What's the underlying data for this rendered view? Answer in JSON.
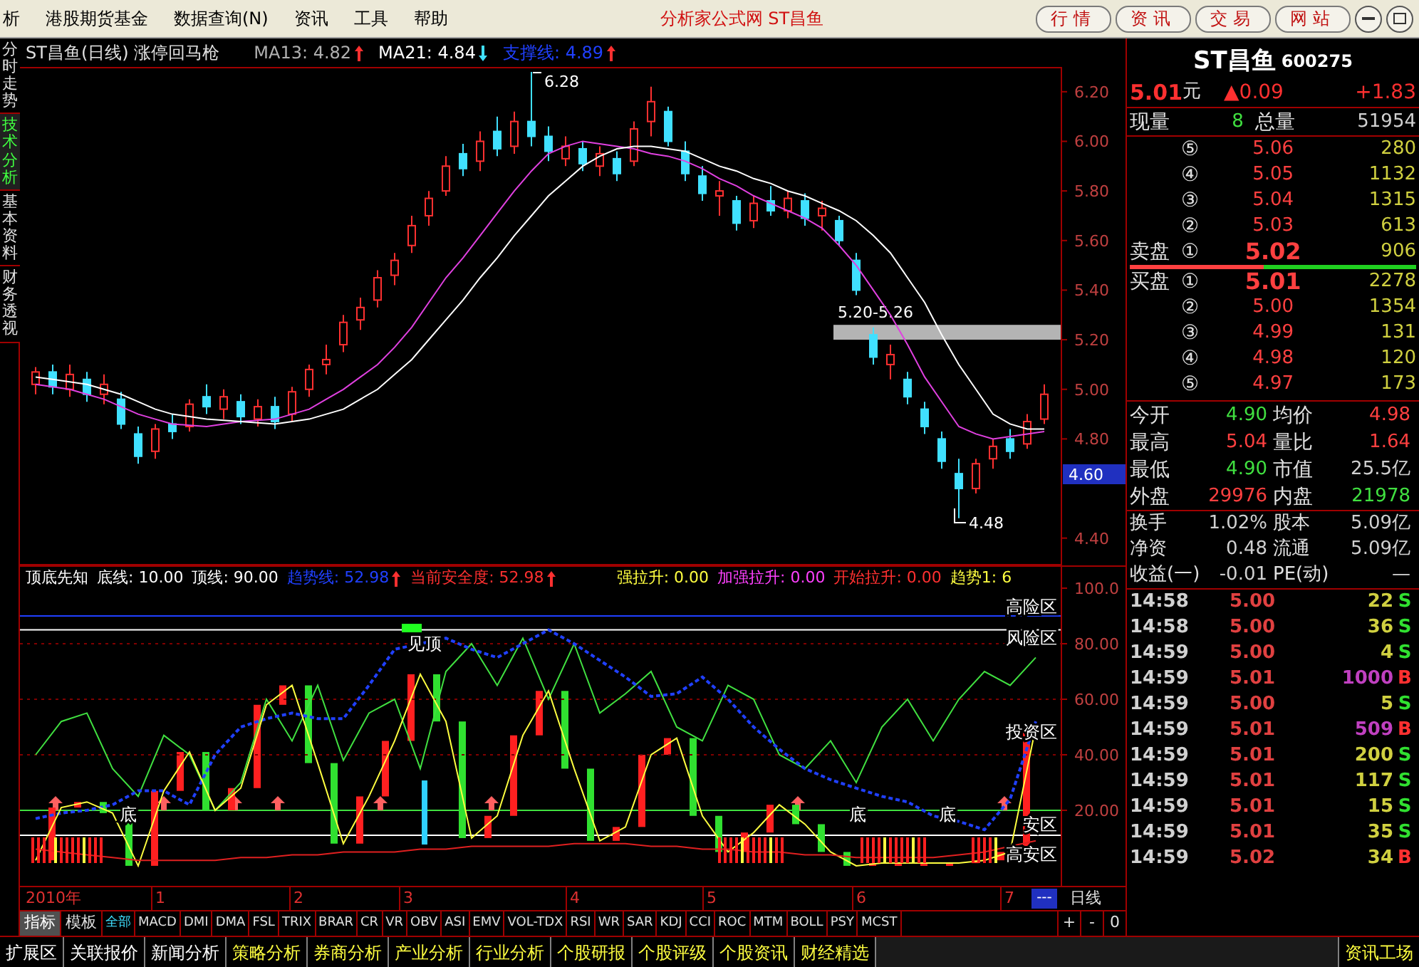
{
  "menu_bar": {
    "items": [
      "析",
      "港股期货基金",
      "数据查询(N)",
      "资讯",
      "工具",
      "帮助"
    ],
    "title": "分析家公式网 ST昌鱼",
    "buttons": [
      "行情",
      "资讯",
      "交易",
      "网站"
    ]
  },
  "side_tabs": [
    {
      "label": "分时走势",
      "selected": false
    },
    {
      "label": "技术分析",
      "selected": true
    },
    {
      "label": "基本资料",
      "selected": false
    },
    {
      "label": "财务透视",
      "selected": false
    }
  ],
  "price_chart": {
    "title": "ST昌鱼(日线) 涨停回马枪",
    "indicators": [
      {
        "label": "MA13: 4.82",
        "color": "#b0b0b0",
        "kind": "up"
      },
      {
        "label": "MA21: 4.84",
        "color": "#ffffff",
        "kind": "down"
      },
      {
        "label": "支撑线: 4.89",
        "color": "#2040ff",
        "kind": "up"
      }
    ],
    "high_label": "6.28",
    "low_label": "4.48",
    "zone_label": "5.20-5.26",
    "current_marker": "4.60",
    "chart_data": {
      "type": "candlestick",
      "ylim": [
        4.29,
        6.3
      ],
      "ohlc": [
        [
          5.02,
          5.09,
          4.98,
          5.07
        ],
        [
          5.07,
          5.1,
          4.98,
          5.01
        ],
        [
          5.0,
          5.1,
          4.97,
          5.06
        ],
        [
          5.04,
          5.07,
          4.95,
          4.98
        ],
        [
          4.98,
          5.06,
          4.94,
          5.02
        ],
        [
          4.96,
          4.99,
          4.84,
          4.86
        ],
        [
          4.82,
          4.85,
          4.7,
          4.73
        ],
        [
          4.75,
          4.86,
          4.72,
          4.84
        ],
        [
          4.86,
          4.9,
          4.8,
          4.83
        ],
        [
          4.85,
          4.96,
          4.83,
          4.94
        ],
        [
          4.97,
          5.02,
          4.9,
          4.93
        ],
        [
          4.92,
          5.0,
          4.88,
          4.97
        ],
        [
          4.95,
          4.98,
          4.86,
          4.89
        ],
        [
          4.88,
          4.96,
          4.85,
          4.93
        ],
        [
          4.93,
          4.97,
          4.84,
          4.87
        ],
        [
          4.9,
          5.01,
          4.87,
          4.99
        ],
        [
          5.0,
          5.1,
          4.97,
          5.08
        ],
        [
          5.1,
          5.18,
          5.06,
          5.12
        ],
        [
          5.18,
          5.3,
          5.15,
          5.27
        ],
        [
          5.28,
          5.37,
          5.24,
          5.33
        ],
        [
          5.36,
          5.48,
          5.33,
          5.45
        ],
        [
          5.46,
          5.55,
          5.42,
          5.52
        ],
        [
          5.58,
          5.7,
          5.55,
          5.66
        ],
        [
          5.7,
          5.8,
          5.66,
          5.77
        ],
        [
          5.8,
          5.94,
          5.78,
          5.9
        ],
        [
          5.95,
          5.99,
          5.86,
          5.89
        ],
        [
          5.92,
          6.04,
          5.88,
          6.0
        ],
        [
          6.04,
          6.1,
          5.94,
          5.97
        ],
        [
          5.98,
          6.12,
          5.95,
          6.08
        ],
        [
          6.08,
          6.28,
          5.98,
          6.02
        ],
        [
          6.02,
          6.06,
          5.92,
          5.96
        ],
        [
          5.93,
          6.02,
          5.9,
          5.98
        ],
        [
          5.97,
          6.0,
          5.88,
          5.91
        ],
        [
          5.9,
          5.98,
          5.86,
          5.95
        ],
        [
          5.93,
          5.96,
          5.84,
          5.87
        ],
        [
          5.92,
          6.08,
          5.9,
          6.05
        ],
        [
          6.08,
          6.22,
          6.02,
          6.16
        ],
        [
          6.12,
          6.14,
          5.98,
          6.0
        ],
        [
          5.96,
          6.0,
          5.84,
          5.87
        ],
        [
          5.86,
          5.9,
          5.76,
          5.79
        ],
        [
          5.78,
          5.84,
          5.7,
          5.8
        ],
        [
          5.76,
          5.78,
          5.64,
          5.67
        ],
        [
          5.68,
          5.78,
          5.65,
          5.75
        ],
        [
          5.76,
          5.82,
          5.7,
          5.72
        ],
        [
          5.72,
          5.8,
          5.69,
          5.77
        ],
        [
          5.76,
          5.79,
          5.66,
          5.69
        ],
        [
          5.7,
          5.76,
          5.64,
          5.73
        ],
        [
          5.68,
          5.7,
          5.58,
          5.6
        ],
        [
          5.52,
          5.55,
          5.38,
          5.4
        ],
        [
          5.22,
          5.25,
          5.1,
          5.13
        ],
        [
          5.1,
          5.18,
          5.04,
          5.14
        ],
        [
          5.04,
          5.07,
          4.94,
          4.97
        ],
        [
          4.92,
          4.95,
          4.82,
          4.85
        ],
        [
          4.8,
          4.83,
          4.68,
          4.71
        ],
        [
          4.66,
          4.72,
          4.48,
          4.6
        ],
        [
          4.6,
          4.72,
          4.58,
          4.7
        ],
        [
          4.72,
          4.8,
          4.68,
          4.77
        ],
        [
          4.8,
          4.84,
          4.72,
          4.75
        ],
        [
          4.78,
          4.9,
          4.76,
          4.87
        ],
        [
          4.88,
          5.02,
          4.86,
          4.98
        ]
      ],
      "yticks": [
        {
          "value": 6.2,
          "label": "6.20"
        },
        {
          "value": 6.0,
          "label": "6.00"
        },
        {
          "value": 5.8,
          "label": "5.80"
        },
        {
          "value": 5.6,
          "label": "5.60"
        },
        {
          "value": 5.4,
          "label": "5.40"
        },
        {
          "value": 5.2,
          "label": "5.20"
        },
        {
          "value": 5.0,
          "label": "5.00"
        },
        {
          "value": 4.8,
          "label": "4.80"
        },
        {
          "value": 4.4,
          "label": "4.40"
        }
      ],
      "series": [
        {
          "type": "line",
          "color": "#e040e0",
          "values": [
            5.02,
            5.01,
            5.0,
            4.98,
            4.96,
            4.93,
            4.9,
            4.88,
            4.86,
            4.855,
            4.85,
            4.86,
            4.87,
            4.875,
            4.88,
            4.9,
            4.92,
            4.96,
            5.0,
            5.05,
            5.1,
            5.17,
            5.25,
            5.35,
            5.45,
            5.53,
            5.62,
            5.71,
            5.8,
            5.88,
            5.95,
            5.98,
            6.0,
            5.99,
            5.98,
            5.97,
            5.95,
            5.94,
            5.92,
            5.89,
            5.85,
            5.82,
            5.78,
            5.75,
            5.72,
            5.69,
            5.65,
            5.58,
            5.5,
            5.4,
            5.3,
            5.18,
            5.05,
            4.95,
            4.85,
            4.82,
            4.8,
            4.81,
            4.82,
            4.83
          ]
        },
        {
          "type": "line",
          "color": "#ffffff",
          "values": [
            5.05,
            5.04,
            5.03,
            5.02,
            5.0,
            4.98,
            4.95,
            4.92,
            4.9,
            4.89,
            4.88,
            4.875,
            4.87,
            4.865,
            4.86,
            4.87,
            4.88,
            4.9,
            4.92,
            4.96,
            5.0,
            5.06,
            5.12,
            5.2,
            5.28,
            5.36,
            5.45,
            5.53,
            5.62,
            5.7,
            5.78,
            5.84,
            5.9,
            5.94,
            5.97,
            5.98,
            5.98,
            5.97,
            5.96,
            5.93,
            5.9,
            5.88,
            5.85,
            5.83,
            5.8,
            5.78,
            5.75,
            5.72,
            5.68,
            5.62,
            5.55,
            5.45,
            5.35,
            5.22,
            5.1,
            5.0,
            4.9,
            4.86,
            4.84,
            4.84
          ]
        }
      ]
    }
  },
  "indicator_chart": {
    "header_left": [
      {
        "label": "顶底先知",
        "color": "#ffffff"
      },
      {
        "label": "底线: 10.00",
        "color": "#ffffff"
      },
      {
        "label": "顶线: 90.00",
        "color": "#ffffff"
      },
      {
        "label": "趋势线: 52.98",
        "color": "#2040ff",
        "kind": "up"
      },
      {
        "label": "当前安全度: 52.98",
        "color": "#ff3030",
        "kind": "up"
      }
    ],
    "header_right": [
      {
        "label": "强拉升: 0.00",
        "color": "#ffff40"
      },
      {
        "label": "加强拉升: 0.00",
        "color": "#ff40ff"
      },
      {
        "label": "开始拉升: 0.00",
        "color": "#ff3030"
      },
      {
        "label": "趋势1: 6",
        "color": "#ffff40"
      }
    ],
    "zone_labels": [
      "高险区",
      "风险区",
      "投资区",
      "安区",
      "高安区"
    ],
    "signal_labels": [
      "底",
      "见顶",
      "底",
      "底"
    ],
    "chart_data": {
      "type": "line",
      "ylim": [
        -7.2,
        107.7
      ],
      "grid": true,
      "yticks": [
        {
          "value": 100,
          "label": "100.0"
        },
        {
          "value": 80,
          "label": "80.00"
        },
        {
          "value": 60,
          "label": "60.00"
        },
        {
          "value": 40,
          "label": "40.00"
        },
        {
          "value": 20,
          "label": "20.00"
        }
      ],
      "series": [
        {
          "color": "#40e040",
          "values": [
            40,
            52,
            55,
            35,
            25,
            47,
            40,
            20,
            30,
            60,
            45,
            65,
            38,
            55,
            60,
            35,
            70,
            80,
            65,
            82,
            60,
            80,
            55,
            62,
            70,
            50,
            45,
            65,
            60,
            40,
            35,
            45,
            30,
            50,
            60,
            45,
            60,
            70,
            65,
            75
          ]
        },
        {
          "color": "#2040ff",
          "line_style": "dashed",
          "values": [
            17,
            19,
            20,
            22,
            27,
            27,
            22,
            40,
            50,
            53,
            55,
            53,
            53,
            65,
            78,
            80,
            82,
            78,
            75,
            80,
            85,
            80,
            74,
            68,
            61,
            62,
            68,
            60,
            50,
            42,
            35,
            31,
            28,
            25,
            23,
            18,
            16,
            13,
            24,
            52
          ]
        },
        {
          "color": "#ffff40",
          "values": [
            2,
            21,
            23,
            19,
            0,
            27,
            41,
            20,
            28,
            58,
            65,
            37,
            8,
            25,
            45,
            69,
            52,
            10,
            18,
            47,
            63,
            35,
            9,
            14,
            40,
            46,
            18,
            5,
            12,
            22,
            15,
            5,
            0,
            1,
            1,
            1,
            1,
            2,
            5,
            50
          ]
        },
        {
          "color": "#e02020",
          "values": [
            6,
            5,
            4,
            3,
            2,
            2,
            2,
            2,
            3,
            3,
            4,
            4,
            5,
            5,
            5,
            6,
            6,
            7,
            7,
            7,
            7,
            8,
            8,
            8,
            7,
            7,
            6,
            6,
            5,
            5,
            4,
            4,
            3,
            3,
            3,
            3,
            4,
            5,
            7,
            9
          ]
        }
      ]
    }
  },
  "time_axis": {
    "year": "2010年",
    "months": [
      "1",
      "2",
      "3",
      "4",
      "5",
      "6",
      "7"
    ],
    "marker": "---",
    "period": "日线"
  },
  "mode_tabs": [
    {
      "label": "指标",
      "selected": true
    },
    {
      "label": "模板",
      "selected": false
    }
  ],
  "indicator_tabs": [
    {
      "label": "全部",
      "selected": true
    },
    {
      "label": "MACD",
      "selected": false
    },
    {
      "label": "DMI",
      "selected": false
    },
    {
      "label": "DMA",
      "selected": false
    },
    {
      "label": "FSL",
      "selected": false
    },
    {
      "label": "TRIX",
      "selected": false
    },
    {
      "label": "BRAR",
      "selected": false
    },
    {
      "label": "CR",
      "selected": false
    },
    {
      "label": "VR",
      "selected": false
    },
    {
      "label": "OBV",
      "selected": false
    },
    {
      "label": "ASI",
      "selected": false
    },
    {
      "label": "EMV",
      "selected": false
    },
    {
      "label": "VOL-TDX",
      "selected": false
    },
    {
      "label": "RSI",
      "selected": false
    },
    {
      "label": "WR",
      "selected": false
    },
    {
      "label": "SAR",
      "selected": false
    },
    {
      "label": "KDJ",
      "selected": false
    },
    {
      "label": "CCI",
      "selected": false
    },
    {
      "label": "ROC",
      "selected": false
    },
    {
      "label": "MTM",
      "selected": false
    },
    {
      "label": "BOLL",
      "selected": false
    },
    {
      "label": "PSY",
      "selected": false
    },
    {
      "label": "MCST",
      "selected": false
    }
  ],
  "zoom_buttons": [
    "+",
    "-",
    "0"
  ],
  "bottom_tabs": [
    {
      "label": "扩展区",
      "kind": "plain"
    },
    {
      "label": "关联报价",
      "kind": "plain"
    },
    {
      "label": "新闻分析",
      "kind": "plain"
    },
    {
      "label": "策略分析",
      "kind": "research"
    },
    {
      "label": "券商分析",
      "kind": "research"
    },
    {
      "label": "产业分析",
      "kind": "research"
    },
    {
      "label": "行业分析",
      "kind": "research"
    },
    {
      "label": "个股研报",
      "kind": "research"
    },
    {
      "label": "个股评级",
      "kind": "research"
    },
    {
      "label": "个股资讯",
      "kind": "research"
    },
    {
      "label": "财经精选",
      "kind": "research"
    }
  ],
  "bottom_right_tab": "资讯工场",
  "quote": {
    "name": "ST昌鱼",
    "code": "600275",
    "price": "5.01",
    "unit": "元",
    "change": "▲0.09",
    "change_pct": "+1.83",
    "volume": [
      {
        "label": "现量",
        "value": "8"
      },
      {
        "label": "总量",
        "value": "51954"
      }
    ],
    "asks": [
      {
        "index": "⑤",
        "price": "5.06",
        "volume": "280"
      },
      {
        "index": "④",
        "price": "5.05",
        "volume": "1132"
      },
      {
        "index": "③",
        "price": "5.04",
        "volume": "1315"
      },
      {
        "index": "②",
        "price": "5.03",
        "volume": "613"
      },
      {
        "label": "卖盘",
        "index": "①",
        "price": "5.02",
        "volume": "906"
      }
    ],
    "level": 0.47,
    "bids": [
      {
        "label": "买盘",
        "index": "①",
        "price": "5.01",
        "volume": "2278"
      },
      {
        "index": "②",
        "price": "5.00",
        "volume": "1354"
      },
      {
        "index": "③",
        "price": "4.99",
        "volume": "131"
      },
      {
        "index": "④",
        "price": "4.98",
        "volume": "120"
      },
      {
        "index": "⑤",
        "price": "4.97",
        "volume": "173"
      }
    ],
    "stats": [
      [
        {
          "label": "今开",
          "value": "4.90",
          "color": "#40e040"
        },
        {
          "label": "均价",
          "value": "4.98",
          "color": "#ff4040"
        }
      ],
      [
        {
          "label": "最高",
          "value": "5.04",
          "color": "#ff4040"
        },
        {
          "label": "量比",
          "value": "1.64",
          "color": "#ff4040"
        }
      ],
      [
        {
          "label": "最低",
          "value": "4.90",
          "color": "#40e040"
        },
        {
          "label": "市值",
          "value": "25.5亿",
          "color": "#d0d0d0"
        }
      ],
      [
        {
          "label": "外盘",
          "value": "29976",
          "color": "#ff4040"
        },
        {
          "label": "内盘",
          "value": "21978",
          "color": "#40e040"
        }
      ]
    ],
    "stats2": [
      [
        {
          "label": "换手",
          "value": "1.02%"
        },
        {
          "label": "股本",
          "value": "5.09亿"
        }
      ],
      [
        {
          "label": "净资",
          "value": "0.48"
        },
        {
          "label": "流通",
          "value": "5.09亿"
        }
      ],
      [
        {
          "label": "收益(一)",
          "value": "-0.01"
        },
        {
          "label": "PE(动)",
          "value": "—"
        }
      ]
    ],
    "ticks": [
      {
        "time": "14:58",
        "price": "5.00",
        "volume": "22",
        "color": "#d0d040",
        "side": "S",
        "kind": "sell"
      },
      {
        "time": "14:58",
        "price": "5.00",
        "volume": "36",
        "color": "#d0d040",
        "side": "S",
        "kind": "sell"
      },
      {
        "time": "14:59",
        "price": "5.00",
        "volume": "4",
        "color": "#d0d040",
        "side": "S",
        "kind": "sell"
      },
      {
        "time": "14:59",
        "price": "5.01",
        "volume": "1000",
        "color": "#c040c0",
        "side": "B",
        "kind": "buy"
      },
      {
        "time": "14:59",
        "price": "5.00",
        "volume": "5",
        "color": "#d0d040",
        "side": "S",
        "kind": "sell"
      },
      {
        "time": "14:59",
        "price": "5.01",
        "volume": "509",
        "color": "#c040c0",
        "side": "B",
        "kind": "buy"
      },
      {
        "time": "14:59",
        "price": "5.01",
        "volume": "200",
        "color": "#d0d040",
        "side": "S",
        "kind": "sell"
      },
      {
        "time": "14:59",
        "price": "5.01",
        "volume": "117",
        "color": "#d0d040",
        "side": "S",
        "kind": "sell"
      },
      {
        "time": "14:59",
        "price": "5.01",
        "volume": "15",
        "color": "#d0d040",
        "side": "S",
        "kind": "sell"
      },
      {
        "time": "14:59",
        "price": "5.01",
        "volume": "35",
        "color": "#d0d040",
        "side": "S",
        "kind": "sell"
      },
      {
        "time": "14:59",
        "price": "5.02",
        "volume": "34",
        "color": "#d0d040",
        "side": "B",
        "kind": "buy"
      }
    ]
  }
}
